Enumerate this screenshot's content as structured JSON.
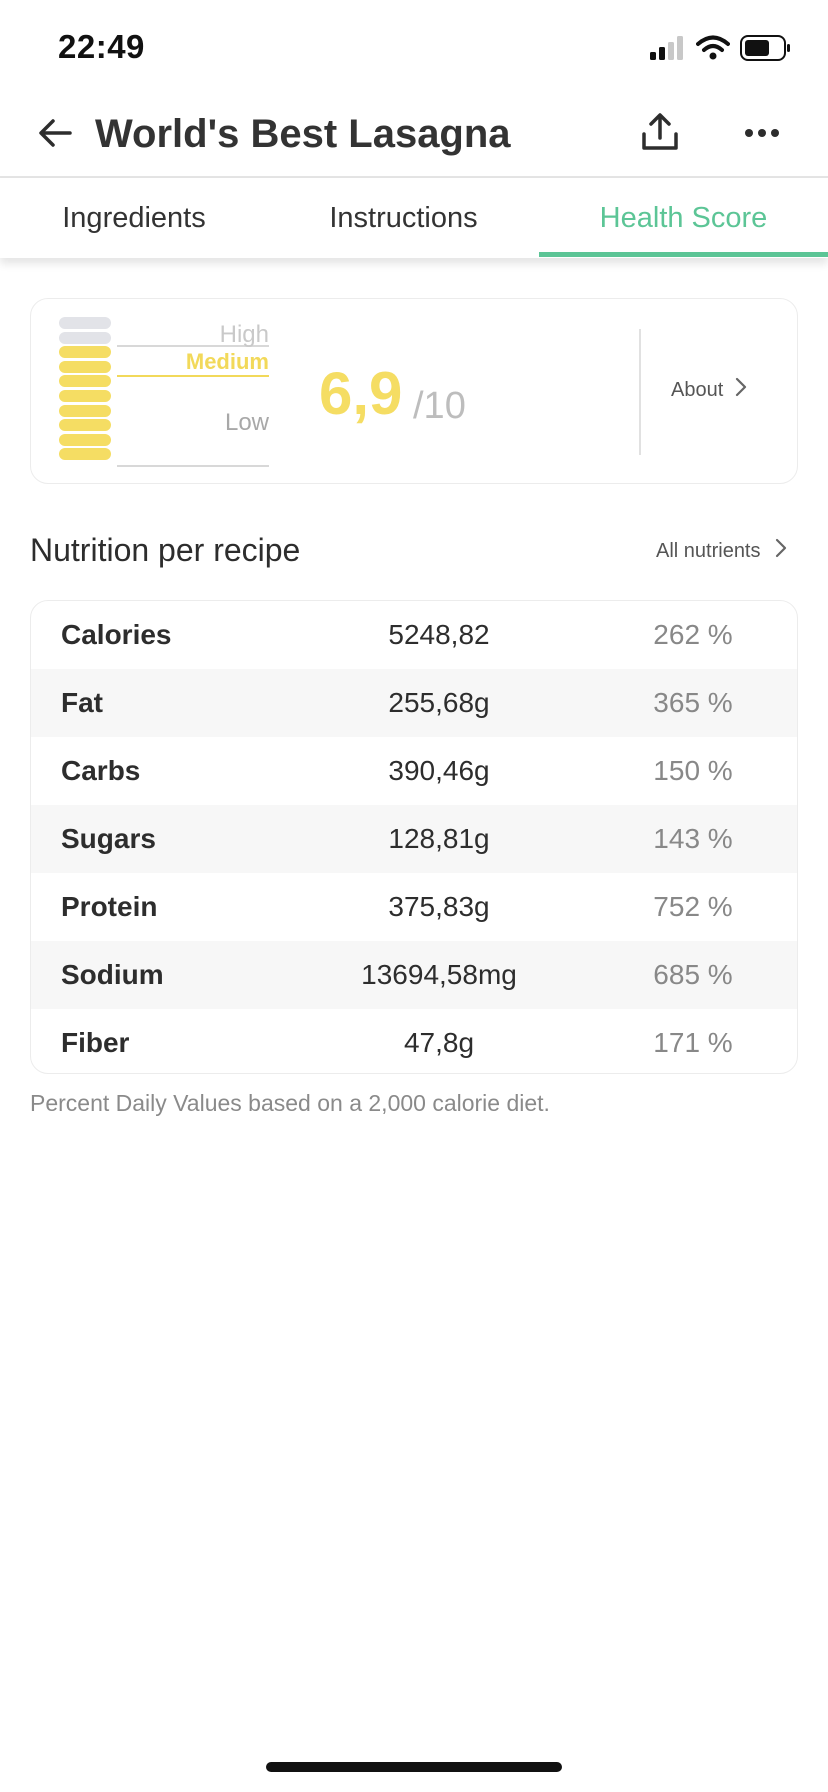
{
  "status_bar": {
    "time": "22:49",
    "icons": [
      "cellular-signal-icon",
      "wifi-icon",
      "battery-icon"
    ]
  },
  "header": {
    "title": "World's Best Lasagna",
    "icons": [
      "back-arrow-icon",
      "share-icon",
      "more-dots-icon"
    ]
  },
  "tabs": [
    {
      "label": "Ingredients",
      "active": false
    },
    {
      "label": "Instructions",
      "active": false
    },
    {
      "label": "Health Score",
      "active": true
    }
  ],
  "health_score": {
    "label_high": "High",
    "label_medium": "Medium",
    "label_low": "Low",
    "value": "6,9",
    "max": "/10",
    "about_label": "About",
    "meter_filled_segments": 8,
    "meter_total_segments": 10
  },
  "nutrition": {
    "title": "Nutrition per recipe",
    "all_nutrients_label": "All nutrients",
    "rows": [
      {
        "name": "Calories",
        "amount": "5248,82",
        "percent": "262 %"
      },
      {
        "name": "Fat",
        "amount": "255,68g",
        "percent": "365 %"
      },
      {
        "name": "Carbs",
        "amount": "390,46g",
        "percent": "150 %"
      },
      {
        "name": "Sugars",
        "amount": "128,81g",
        "percent": "143 %"
      },
      {
        "name": "Protein",
        "amount": "375,83g",
        "percent": "752 %"
      },
      {
        "name": "Sodium",
        "amount": "13694,58mg",
        "percent": "685 %"
      },
      {
        "name": "Fiber",
        "amount": "47,8g",
        "percent": "171 %"
      }
    ],
    "footnote": "Percent Daily Values based on a 2,000 calorie diet."
  },
  "colors": {
    "accent_green": "#5cc596",
    "score_yellow": "#f5dd63",
    "meter_empty": "#e2e3e8"
  }
}
